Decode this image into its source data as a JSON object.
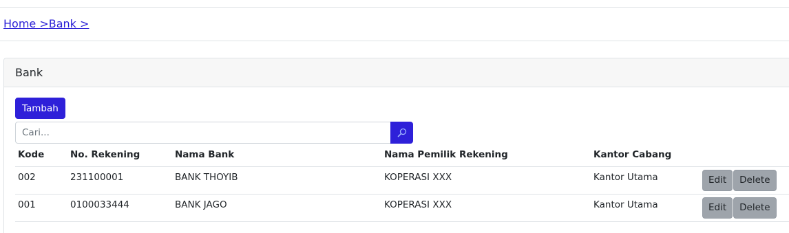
{
  "breadcrumb": {
    "home": "Home >",
    "bank": "Bank >"
  },
  "card": {
    "title": "Bank",
    "add_button": "Tambah",
    "search": {
      "placeholder": "Cari...",
      "value": "",
      "icon": "search-icon"
    }
  },
  "table": {
    "headers": [
      "Kode",
      "No. Rekening",
      "Nama Bank",
      "Nama Pemilik Rekening",
      "Kantor Cabang"
    ],
    "rows": [
      {
        "kode": "002",
        "rekening": "231100001",
        "bank": "BANK THOYIB",
        "pemilik": "KOPERASI XXX",
        "cabang": "Kantor Utama",
        "edit": "Edit",
        "delete": "Delete"
      },
      {
        "kode": "001",
        "rekening": "0100033444",
        "bank": "BANK JAGO",
        "pemilik": "KOPERASI XXX",
        "cabang": "Kantor Utama",
        "edit": "Edit",
        "delete": "Delete"
      }
    ]
  },
  "colors": {
    "primary": "#2e20d9",
    "secondary": "#9ea4ab",
    "link": "#2a1fd6"
  }
}
